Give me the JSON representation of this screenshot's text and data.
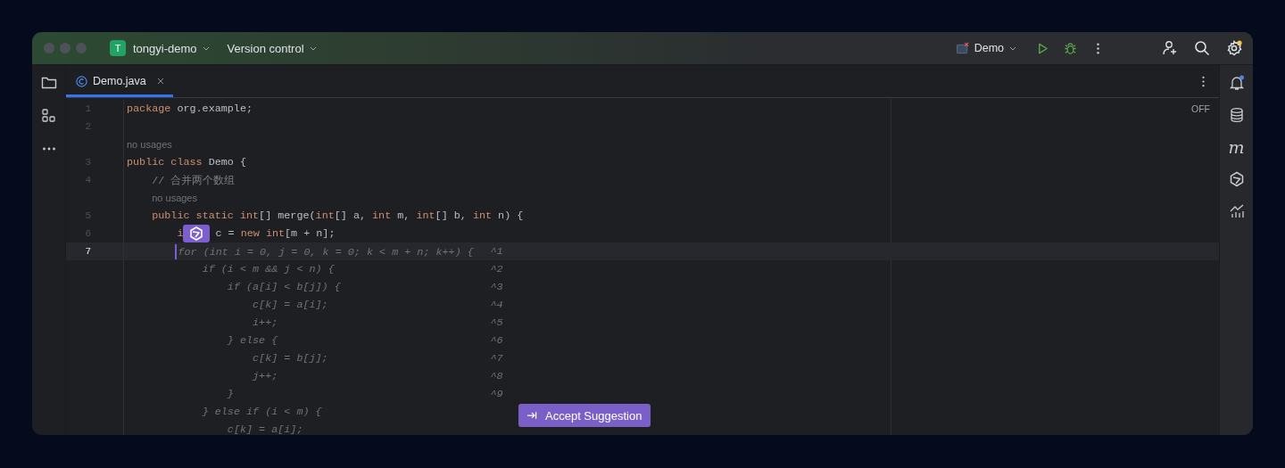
{
  "title_bar": {
    "project_initial": "T",
    "project": "tongyi-demo",
    "vcs": "Version control",
    "run_config": "Demo"
  },
  "tabs": [
    {
      "label": "Demo.java",
      "selected": true
    }
  ],
  "editor": {
    "status": "OFF",
    "lines": [
      {
        "kind": "code",
        "number": "1",
        "current": false,
        "tokens": [
          {
            "kind": "keyword",
            "t": "package"
          },
          {
            "kind": "plain",
            "t": " org.example;"
          }
        ]
      },
      {
        "kind": "code",
        "number": "2",
        "current": false
      },
      {
        "kind": "hint",
        "text": "no usages"
      },
      {
        "kind": "code",
        "number": "3",
        "current": false,
        "tokens": [
          {
            "kind": "keyword",
            "t": "public"
          },
          {
            "kind": "keyword",
            "t": " class"
          },
          {
            "kind": "plain",
            "t": " Demo {"
          }
        ]
      },
      {
        "kind": "code",
        "number": "4",
        "current": false,
        "tokens": [
          {
            "kind": "comment",
            "t": "    // 合并两个数组"
          }
        ]
      },
      {
        "kind": "hint",
        "text": "    no usages"
      },
      {
        "kind": "code",
        "number": "5",
        "current": false,
        "tokens": [
          {
            "kind": "keyword",
            "t": "    public"
          },
          {
            "kind": "keyword",
            "t": " static"
          },
          {
            "kind": "keyword",
            "t": " int"
          },
          {
            "kind": "plain",
            "t": "[] merge("
          },
          {
            "kind": "keyword",
            "t": "int"
          },
          {
            "kind": "plain",
            "t": "[] a, "
          },
          {
            "kind": "keyword",
            "t": "int"
          },
          {
            "kind": "plain",
            "t": " m, "
          },
          {
            "kind": "keyword",
            "t": "int"
          },
          {
            "kind": "plain",
            "t": "[] b, "
          },
          {
            "kind": "keyword",
            "t": "int"
          },
          {
            "kind": "plain",
            "t": " n) {"
          }
        ]
      },
      {
        "kind": "code",
        "number": "6",
        "current": false,
        "tokens": [
          {
            "kind": "keyword",
            "t": "        i"
          },
          {
            "kind": "popup"
          },
          {
            "kind": "plain",
            "t": "c = "
          },
          {
            "kind": "keyword",
            "t": "new int"
          },
          {
            "kind": "plain",
            "t": "[m + n];"
          }
        ]
      },
      {
        "kind": "ghost",
        "number": "7",
        "current": true,
        "text": "        for (int i = 0, j = 0, k = 0; k < m + n; k++) {",
        "mark": "^1"
      },
      {
        "kind": "ghost",
        "current": false,
        "text": "            if (i < m && j < n) {",
        "mark": "^2"
      },
      {
        "kind": "ghost",
        "current": false,
        "text": "                if (a[i] < b[j]) {",
        "mark": "^3"
      },
      {
        "kind": "ghost",
        "current": false,
        "text": "                    c[k] = a[i];",
        "mark": "^4"
      },
      {
        "kind": "ghost",
        "current": false,
        "text": "                    i++;",
        "mark": "^5"
      },
      {
        "kind": "ghost",
        "current": false,
        "text": "                } else {",
        "mark": "^6"
      },
      {
        "kind": "ghost",
        "current": false,
        "text": "                    c[k] = b[j];",
        "mark": "^7"
      },
      {
        "kind": "ghost",
        "current": false,
        "text": "                    j++;",
        "mark": "^8"
      },
      {
        "kind": "ghost",
        "current": false,
        "text": "                }",
        "mark": "^9"
      },
      {
        "kind": "ghost",
        "current": false,
        "text": "            } else if (i < m) {"
      },
      {
        "kind": "ghost",
        "current": false,
        "text": "                c[k] = a[i];"
      }
    ]
  },
  "right_toolbar": {
    "glyph": "m"
  },
  "accept_button": {
    "label": "Accept Suggestion"
  }
}
